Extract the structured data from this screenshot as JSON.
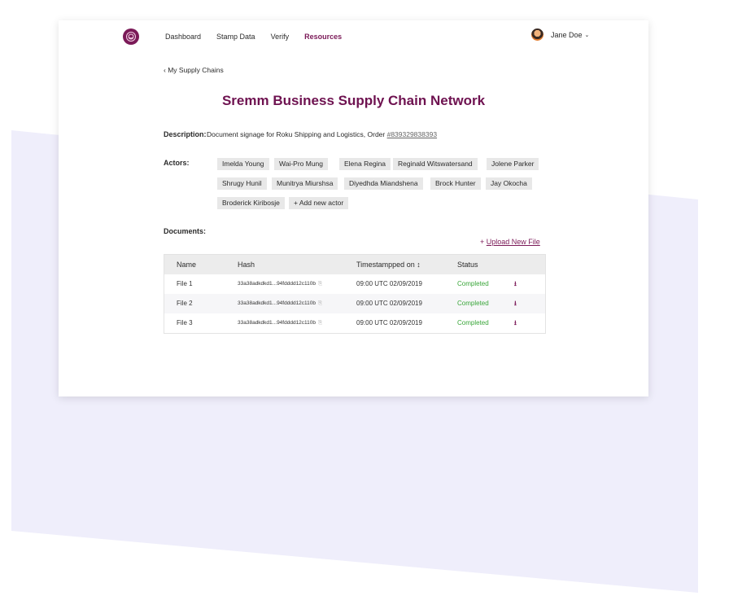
{
  "nav": {
    "items": [
      {
        "label": "Dashboard"
      },
      {
        "label": "Stamp Data"
      },
      {
        "label": "Verify"
      },
      {
        "label": "Resources"
      }
    ],
    "active_index": 3
  },
  "user": {
    "name": "Jane Doe",
    "caret": "⌄"
  },
  "breadcrumb": {
    "back_label": "My Supply Chains",
    "back_glyph": "‹"
  },
  "page": {
    "title": "Sremm Business Supply Chain Network"
  },
  "description": {
    "label": "Description:",
    "text": "Document signage for Roku Shipping and Logistics, Order ",
    "order_number": "#839329838393"
  },
  "actors": {
    "label": "Actors:",
    "items": [
      "Imelda Young",
      "Wai-Pro Mung",
      "Elena Regina",
      "Reginald Witswatersand",
      "Jolene Parker",
      "Shrugy Hunil",
      "Munitrya Miurshsa",
      "Diyedhda Miandshena",
      "Brock Hunter",
      "Jay Okocha",
      "Broderick Kiribosje"
    ],
    "add_label": "+ Add new actor"
  },
  "documents": {
    "label": "Documents:",
    "upload_prefix": "+ ",
    "upload_label": "Upload New File",
    "columns": [
      "Name",
      "Hash",
      "Timestampped on ↕",
      "Status"
    ],
    "rows": [
      {
        "name": "File 1",
        "hash": "33a38adkdkd1...94fdddd12c110b",
        "timestamp": "09:00 UTC 02/09/2019",
        "status": "Completed"
      },
      {
        "name": "File 2",
        "hash": "33a38adkdkd1...94fdddd12c110b",
        "timestamp": "09:00 UTC 02/09/2019",
        "status": "Completed"
      },
      {
        "name": "File 3",
        "hash": "33a38adkdkd1...94fdddd12c110b",
        "timestamp": "09:00 UTC 02/09/2019",
        "status": "Completed"
      }
    ]
  },
  "icons": {
    "logo": "stamp-logo-icon",
    "copy": "copy-icon",
    "download": "download-icon",
    "download_glyph": "⭳",
    "copy_glyph": "⎘"
  },
  "colors": {
    "brand": "#7b1a58",
    "title": "#6e1250",
    "status_completed": "#3aa63a",
    "background_shape": "#efeefb"
  }
}
